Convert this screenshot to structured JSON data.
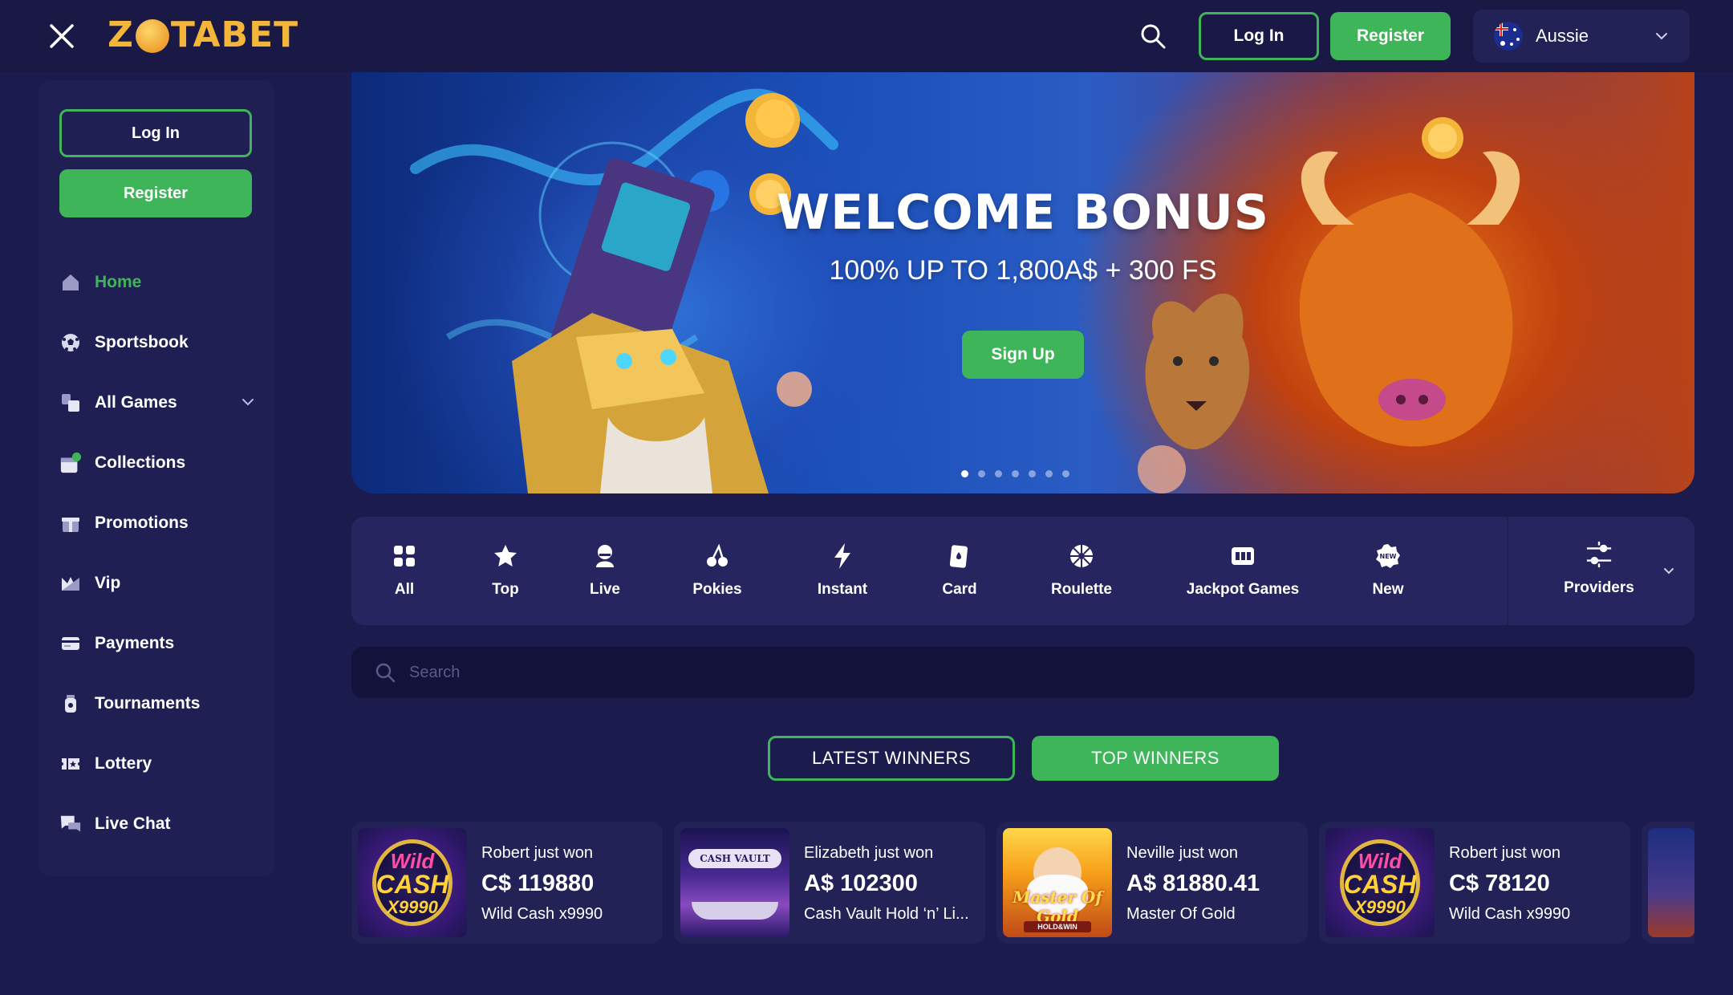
{
  "header": {
    "logo_text_a": "Z",
    "logo_text_b": "TABET",
    "login_label": "Log In",
    "register_label": "Register",
    "language": "Aussie"
  },
  "sidebar": {
    "login_label": "Log In",
    "register_label": "Register",
    "items": [
      {
        "label": "Home",
        "icon": "home-icon",
        "active": true
      },
      {
        "label": "Sportsbook",
        "icon": "soccer-ball-icon"
      },
      {
        "label": "All Games",
        "icon": "games-icon",
        "expandable": true
      },
      {
        "label": "Collections",
        "icon": "collections-icon"
      },
      {
        "label": "Promotions",
        "icon": "gift-icon"
      },
      {
        "label": "Vip",
        "icon": "vip-icon"
      },
      {
        "label": "Payments",
        "icon": "card-icon"
      },
      {
        "label": "Tournaments",
        "icon": "trophy-icon"
      },
      {
        "label": "Lottery",
        "icon": "ticket-icon"
      },
      {
        "label": "Live Chat",
        "icon": "chat-icon"
      }
    ]
  },
  "hero": {
    "title": "WELCOME BONUS",
    "subtitle": "100% UP TO 1,800A$ + 300 FS",
    "cta": "Sign Up"
  },
  "categories": [
    {
      "label": "All",
      "icon": "grid-icon"
    },
    {
      "label": "Top",
      "icon": "star-icon"
    },
    {
      "label": "Live",
      "icon": "dealer-icon"
    },
    {
      "label": "Pokies",
      "icon": "cherry-icon"
    },
    {
      "label": "Instant",
      "icon": "lightning-icon"
    },
    {
      "label": "Card",
      "icon": "card-suit-icon"
    },
    {
      "label": "Roulette",
      "icon": "roulette-icon"
    },
    {
      "label": "Jackpot Games",
      "icon": "jackpot-icon"
    },
    {
      "label": "New",
      "icon": "new-badge-icon"
    },
    {
      "label": "Providers",
      "icon": "sliders-icon"
    }
  ],
  "search": {
    "placeholder": "Search"
  },
  "winner_tabs": {
    "latest": "LATEST WINNERS",
    "top": "TOP WINNERS"
  },
  "winners": [
    {
      "name": "Robert just won",
      "amount": "C$ 119880",
      "game": "Wild Cash x9990"
    },
    {
      "name": "Elizabeth just won",
      "amount": "A$ 102300",
      "game": "Cash Vault Hold ‘n’ Li..."
    },
    {
      "name": "Neville just won",
      "amount": "A$ 81880.41",
      "game": "Master Of Gold"
    },
    {
      "name": "Robert just won",
      "amount": "C$ 78120",
      "game": "Wild Cash x9990"
    }
  ],
  "thumbs": {
    "wild_1": "Wild",
    "wild_2": "CASH",
    "wild_3": "X9990",
    "vault": "CASH VAULT",
    "master": "Master Of Gold",
    "holdwin": "HOLD&WIN"
  },
  "colors": {
    "background": "#1c1b4d",
    "accent": "#3fb559",
    "logo": "#f3b63a"
  }
}
